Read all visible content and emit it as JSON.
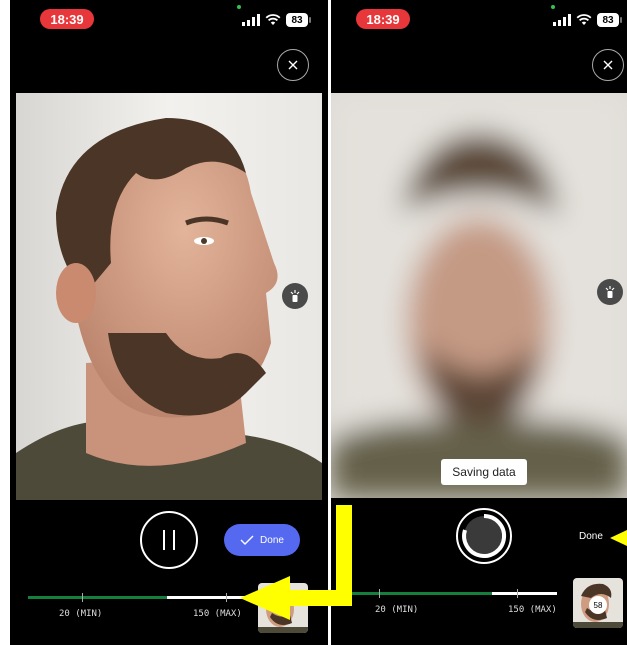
{
  "left_screen": {
    "status": {
      "time": "18:39",
      "battery": "83"
    },
    "controls": {
      "done_label": "Done"
    },
    "progress": {
      "min_label": "20 (MIN)",
      "max_label": "150 (MAX)",
      "fill_fraction": 0.58
    }
  },
  "right_screen": {
    "status": {
      "time": "18:39",
      "battery": "83"
    },
    "saving_label": "Saving data",
    "controls": {
      "done_label": "Done"
    },
    "progress": {
      "min_label": "20 (MIN)",
      "max_label": "150 (MAX)",
      "fill_fraction": 0.7
    },
    "capture_count": "58"
  },
  "icons": {
    "close": "close-icon",
    "pause": "pause-icon",
    "checkmark": "checkmark-icon",
    "side": "exposure-icon",
    "loader": "loading-spinner-icon"
  },
  "colors": {
    "status_pill": "#e8373a",
    "done_button": "#5468f0",
    "progress_fill": "#15803d",
    "annotation_arrow": "#ffff00"
  }
}
